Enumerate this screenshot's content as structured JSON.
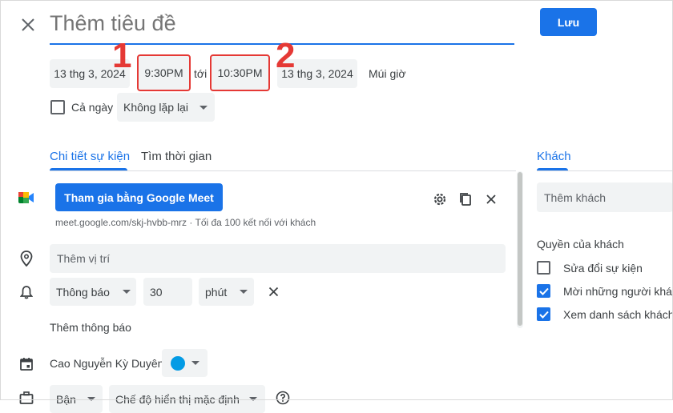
{
  "header": {
    "title_placeholder": "Thêm tiêu đề",
    "save_label": "Lưu"
  },
  "datetime": {
    "start_date": "13 thg 3, 2024",
    "start_time": "9:30PM",
    "to_label": "tới",
    "end_time": "10:30PM",
    "end_date": "13 thg 3, 2024",
    "timezone_label": "Múi giờ"
  },
  "annotations": {
    "marker_1": "1",
    "marker_2": "2",
    "marker_color": "#e53935"
  },
  "options": {
    "all_day_label": "Cả ngày",
    "all_day_checked": false,
    "repeat_value": "Không lặp lại"
  },
  "tabs": [
    {
      "label": "Chi tiết sự kiện",
      "active": true
    },
    {
      "label": "Tìm thời gian",
      "active": false
    }
  ],
  "details": {
    "meet_button_label": "Tham gia bằng Google Meet",
    "meet_info": "meet.google.com/skj-hvbb-mrz · Tối đa 100 kết nối với khách",
    "location_placeholder": "Thêm vị trí",
    "notification": {
      "type": "Thông báo",
      "amount": "30",
      "unit": "phút"
    },
    "add_notification_label": "Thêm thông báo",
    "calendar_owner": "Cao Nguyễn Kỳ Duyên",
    "calendar_color": "#039be5",
    "busy_value": "Bận",
    "visibility_value": "Chế độ hiển thị mặc định"
  },
  "guests": {
    "tab_label": "Khách",
    "add_guest_placeholder": "Thêm khách",
    "permissions_title": "Quyền của khách",
    "permissions": [
      {
        "label": "Sửa đổi sự kiện",
        "checked": false
      },
      {
        "label": "Mời những người khác",
        "checked": true
      },
      {
        "label": "Xem danh sách khách",
        "checked": true
      }
    ]
  },
  "colors": {
    "accent": "#1a73e8",
    "chip_bg": "#f1f3f4",
    "text": "#3c4043",
    "muted": "#5f6368"
  }
}
